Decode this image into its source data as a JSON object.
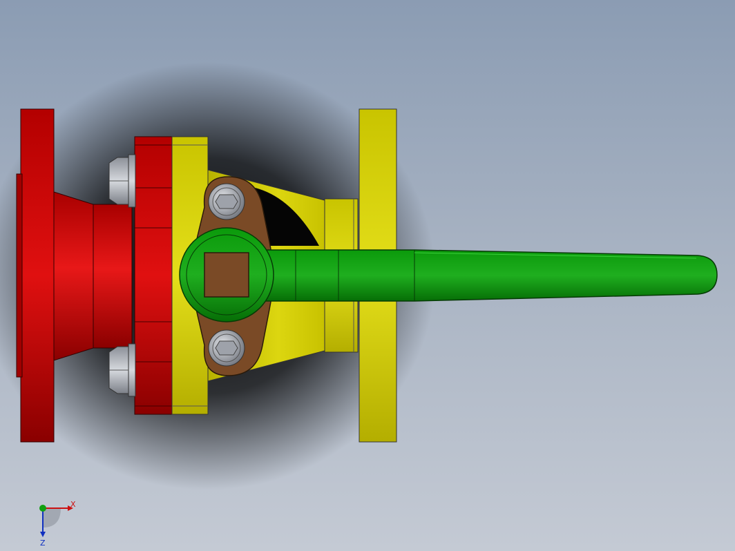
{
  "triad": {
    "x_label": "X",
    "z_label": "Z"
  },
  "colors": {
    "left_flange": "#cc0000",
    "body": "#d6d000",
    "right_flange": "#d4d000",
    "handle": "#0a8c0a",
    "gland_plate": "#7a4a26",
    "bolt": "#b8bcc4",
    "background_top": "#8b9cb3",
    "background_bottom": "#c4cad4",
    "triad_x": "#cc1010",
    "triad_y": "#10a010",
    "triad_z": "#1030c0"
  },
  "parts": {
    "left_flange": "flange",
    "body": "valve-body",
    "right_flange": "flange",
    "handle": "lever-handle",
    "gland_plate": "gland-plate",
    "bolts": [
      "hex-bolt-top",
      "hex-bolt-bottom",
      "socket-screw-top",
      "socket-screw-bottom"
    ]
  }
}
